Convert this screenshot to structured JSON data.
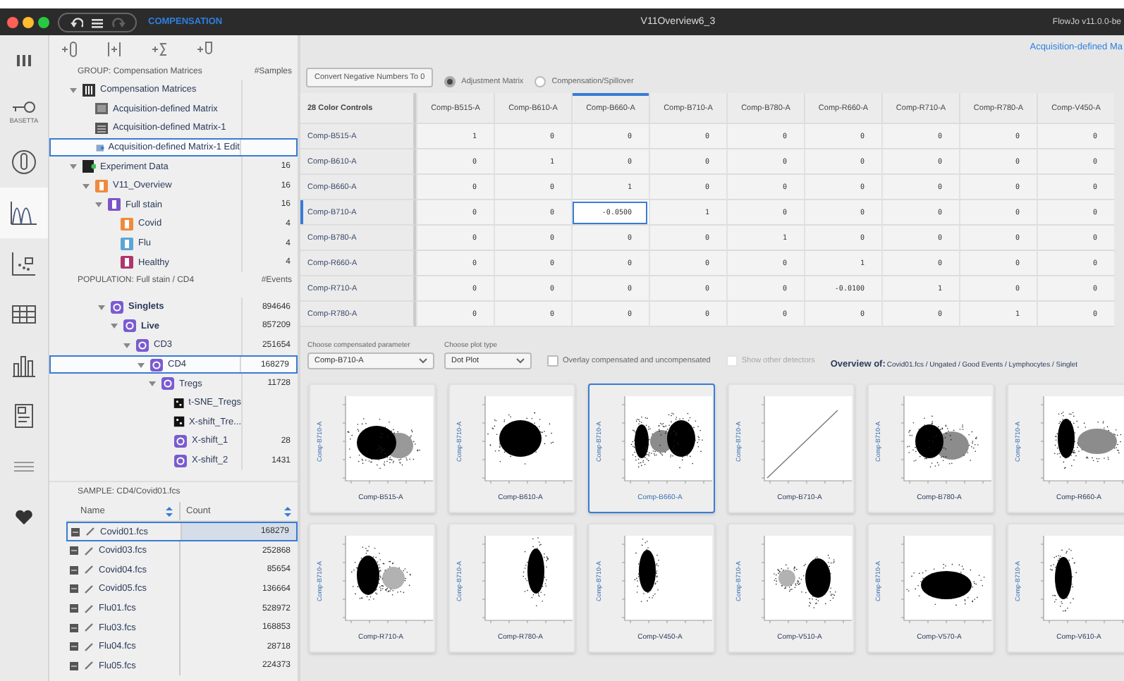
{
  "window": {
    "mode_label": "COMPENSATION",
    "title": "V11Overview6_3",
    "app_version": "FlowJo v11.0.0-be"
  },
  "history_buttons": [
    {
      "kind": "undo",
      "disabled": false
    },
    {
      "kind": "list",
      "disabled": false
    },
    {
      "kind": "redo",
      "disabled": true
    }
  ],
  "rail": [
    {
      "kind": "columns",
      "selected": false
    },
    {
      "kind": "key",
      "label": "BASETTA",
      "selected": false
    },
    {
      "kind": "tube",
      "selected": false
    },
    {
      "kind": "histogram",
      "selected": true
    },
    {
      "kind": "scatter",
      "selected": false
    },
    {
      "kind": "table",
      "selected": false
    },
    {
      "kind": "bars",
      "selected": false
    },
    {
      "kind": "report",
      "selected": false
    },
    {
      "kind": "lines",
      "selected": false
    },
    {
      "kind": "heart",
      "selected": false
    }
  ],
  "group_panel": {
    "header": "GROUP: Compensation Matrices",
    "count_header": "#Samples",
    "tree": [
      {
        "label": "Compensation Matrices",
        "kind": "matrix-group",
        "expanded": true,
        "selected": false,
        "children": [
          {
            "label": "Acquisition-defined Matrix",
            "kind": "matrix",
            "selected": false
          },
          {
            "label": "Acquisition-defined Matrix-1",
            "kind": "matrix-list",
            "selected": false
          },
          {
            "label": "Acquisition-defined Matrix-1 Edit",
            "kind": "matrix-edit",
            "selected": true
          }
        ]
      },
      {
        "label": "Experiment Data",
        "kind": "experiment",
        "count": "16",
        "expanded": true,
        "selected": false,
        "children": [
          {
            "label": "V11_Overview",
            "kind": "group",
            "color": "#f08a3c",
            "count": "16",
            "expanded": true,
            "selected": false,
            "children": [
              {
                "label": "Full stain",
                "kind": "group",
                "color": "#7a55c8",
                "count": "16",
                "expanded": true,
                "selected": false,
                "children": [
                  {
                    "label": "Covid",
                    "kind": "group",
                    "color": "#f08a3c",
                    "count": "4",
                    "selected": false
                  },
                  {
                    "label": "Flu",
                    "kind": "group",
                    "color": "#5aa5d8",
                    "count": "4",
                    "selected": false
                  },
                  {
                    "label": "Healthy",
                    "kind": "group",
                    "color": "#b0356c",
                    "count": "4",
                    "selected": false
                  }
                ]
              }
            ]
          }
        ]
      }
    ]
  },
  "population_panel": {
    "header": "POPULATION: Full stain / CD4",
    "count_header": "#Events",
    "tree": [
      {
        "label": "Singlets",
        "kind": "gate",
        "bold": true,
        "count": "894646",
        "expanded": true,
        "selected": false,
        "children": [
          {
            "label": "Live",
            "kind": "gate",
            "bold": true,
            "count": "857209",
            "expanded": true,
            "selected": false,
            "children": [
              {
                "label": "CD3",
                "kind": "gate",
                "bold": false,
                "count": "251654",
                "expanded": true,
                "selected": false,
                "children": [
                  {
                    "label": "CD4",
                    "kind": "gate",
                    "bold": false,
                    "count": "168279",
                    "expanded": true,
                    "selected": true,
                    "children": [
                      {
                        "label": "Tregs",
                        "kind": "gate",
                        "bold": false,
                        "count": "11728",
                        "expanded": true,
                        "selected": false,
                        "children": [
                          {
                            "label": "t-SNE_Tregs",
                            "kind": "plot",
                            "bold": false,
                            "selected": false
                          },
                          {
                            "label": "X-shift_Tre...",
                            "kind": "plot",
                            "bold": false,
                            "selected": false
                          },
                          {
                            "label": "X-shift_1",
                            "kind": "gate",
                            "bold": false,
                            "count": "28",
                            "selected": false
                          },
                          {
                            "label": "X-shift_2",
                            "kind": "gate",
                            "bold": false,
                            "count": "1431",
                            "selected": false
                          }
                        ]
                      }
                    ]
                  }
                ]
              }
            ]
          }
        ]
      }
    ]
  },
  "sample_panel": {
    "header": "SAMPLE: CD4/Covid01.fcs",
    "columns": [
      "Name",
      "Count"
    ],
    "rows": [
      {
        "name": "Covid01.fcs",
        "count": "168279",
        "selected": true
      },
      {
        "name": "Covid03.fcs",
        "count": "252868",
        "selected": false
      },
      {
        "name": "Covid04.fcs",
        "count": "85654",
        "selected": false
      },
      {
        "name": "Covid05.fcs",
        "count": "136664",
        "selected": false
      },
      {
        "name": "Flu01.fcs",
        "count": "528972",
        "selected": false
      },
      {
        "name": "Flu03.fcs",
        "count": "168853",
        "selected": false
      },
      {
        "name": "Flu04.fcs",
        "count": "28718",
        "selected": false
      },
      {
        "name": "Flu05.fcs",
        "count": "224373",
        "selected": false
      }
    ]
  },
  "matrix": {
    "link": "Acquisition-defined Ma",
    "convert_button": "Convert Negative Numbers To 0",
    "radios": [
      {
        "label": "Adjustment Matrix",
        "selected": true
      },
      {
        "label": "Compensation/Spillover",
        "selected": false
      }
    ],
    "corner": "28 Color Controls",
    "columns": [
      {
        "label": "Comp-B515-A",
        "selected": false
      },
      {
        "label": "Comp-B610-A",
        "selected": false
      },
      {
        "label": "Comp-B660-A",
        "selected": true
      },
      {
        "label": "Comp-B710-A",
        "selected": false
      },
      {
        "label": "Comp-B780-A",
        "selected": false
      },
      {
        "label": "Comp-R660-A",
        "selected": false
      },
      {
        "label": "Comp-R710-A",
        "selected": false
      },
      {
        "label": "Comp-R780-A",
        "selected": false
      },
      {
        "label": "Comp-V450-A",
        "selected": false
      }
    ],
    "rows": [
      {
        "label": "Comp-B515-A",
        "selected": false,
        "cells": [
          "1",
          "0",
          "0",
          "0",
          "0",
          "0",
          "0",
          "0",
          "0"
        ]
      },
      {
        "label": "Comp-B610-A",
        "selected": false,
        "cells": [
          "0",
          "1",
          "0",
          "0",
          "0",
          "0",
          "0",
          "0",
          "0"
        ]
      },
      {
        "label": "Comp-B660-A",
        "selected": false,
        "cells": [
          "0",
          "0",
          "1",
          "0",
          "0",
          "0",
          "0",
          "0",
          "0"
        ]
      },
      {
        "label": "Comp-B710-A",
        "selected": true,
        "cells": [
          "0",
          "0",
          "-0.0500",
          "1",
          "0",
          "0",
          "0",
          "0",
          "0"
        ]
      },
      {
        "label": "Comp-B780-A",
        "selected": false,
        "cells": [
          "0",
          "0",
          "0",
          "0",
          "1",
          "0",
          "0",
          "0",
          "0"
        ]
      },
      {
        "label": "Comp-R660-A",
        "selected": false,
        "cells": [
          "0",
          "0",
          "0",
          "0",
          "0",
          "1",
          "0",
          "0",
          "0"
        ]
      },
      {
        "label": "Comp-R710-A",
        "selected": false,
        "cells": [
          "0",
          "0",
          "0",
          "0",
          "0",
          "-0.0100",
          "1",
          "0",
          "0"
        ]
      },
      {
        "label": "Comp-R780-A",
        "selected": false,
        "cells": [
          "0",
          "0",
          "0",
          "0",
          "0",
          "0",
          "0",
          "1",
          "0"
        ]
      }
    ]
  },
  "controls": {
    "parameter": {
      "label": "Choose compensated parameter",
      "value": "Comp-B710-A"
    },
    "plot_type": {
      "label": "Choose plot type",
      "value": "Dot Plot"
    },
    "checkboxes": [
      {
        "label": "Overlay compensated and uncompensated",
        "checked": false,
        "disabled": false
      },
      {
        "label": "Show other detectors",
        "checked": false,
        "disabled": true
      }
    ],
    "overview_label": "Overview of:",
    "overview_path": "Covid01.fcs / Ungated / Good Events / Lymphocytes / Singlet"
  },
  "plots": [
    {
      "x_label": "Comp-B515-A",
      "y_label": "Comp-B710-A",
      "kind": "scatter",
      "selected": false
    },
    {
      "x_label": "Comp-B610-A",
      "y_label": "Comp-B710-A",
      "kind": "scatter",
      "selected": false
    },
    {
      "x_label": "Comp-B660-A",
      "y_label": "Comp-B710-A",
      "kind": "scatter",
      "selected": true
    },
    {
      "x_label": "Comp-B710-A",
      "y_label": "Comp-B710-A",
      "kind": "diagonal",
      "selected": false
    },
    {
      "x_label": "Comp-B780-A",
      "y_label": "Comp-B710-A",
      "kind": "scatter",
      "selected": false
    },
    {
      "x_label": "Comp-R660-A",
      "y_label": "Comp-B710-A",
      "kind": "scatter",
      "selected": false
    },
    {
      "x_label": "Comp-R710-A",
      "y_label": "Comp-B710-A",
      "kind": "scatter",
      "selected": false
    },
    {
      "x_label": "Comp-R780-A",
      "y_label": "Comp-B710-A",
      "kind": "scatter",
      "selected": false
    },
    {
      "x_label": "Comp-V450-A",
      "y_label": "Comp-B710-A",
      "kind": "scatter",
      "selected": false
    },
    {
      "x_label": "Comp-V510-A",
      "y_label": "Comp-B710-A",
      "kind": "scatter",
      "selected": false
    },
    {
      "x_label": "Comp-V570-A",
      "y_label": "Comp-B710-A",
      "kind": "scatter",
      "selected": false
    },
    {
      "x_label": "Comp-V610-A",
      "y_label": "Comp-B710-A",
      "kind": "scatter",
      "selected": false
    }
  ]
}
